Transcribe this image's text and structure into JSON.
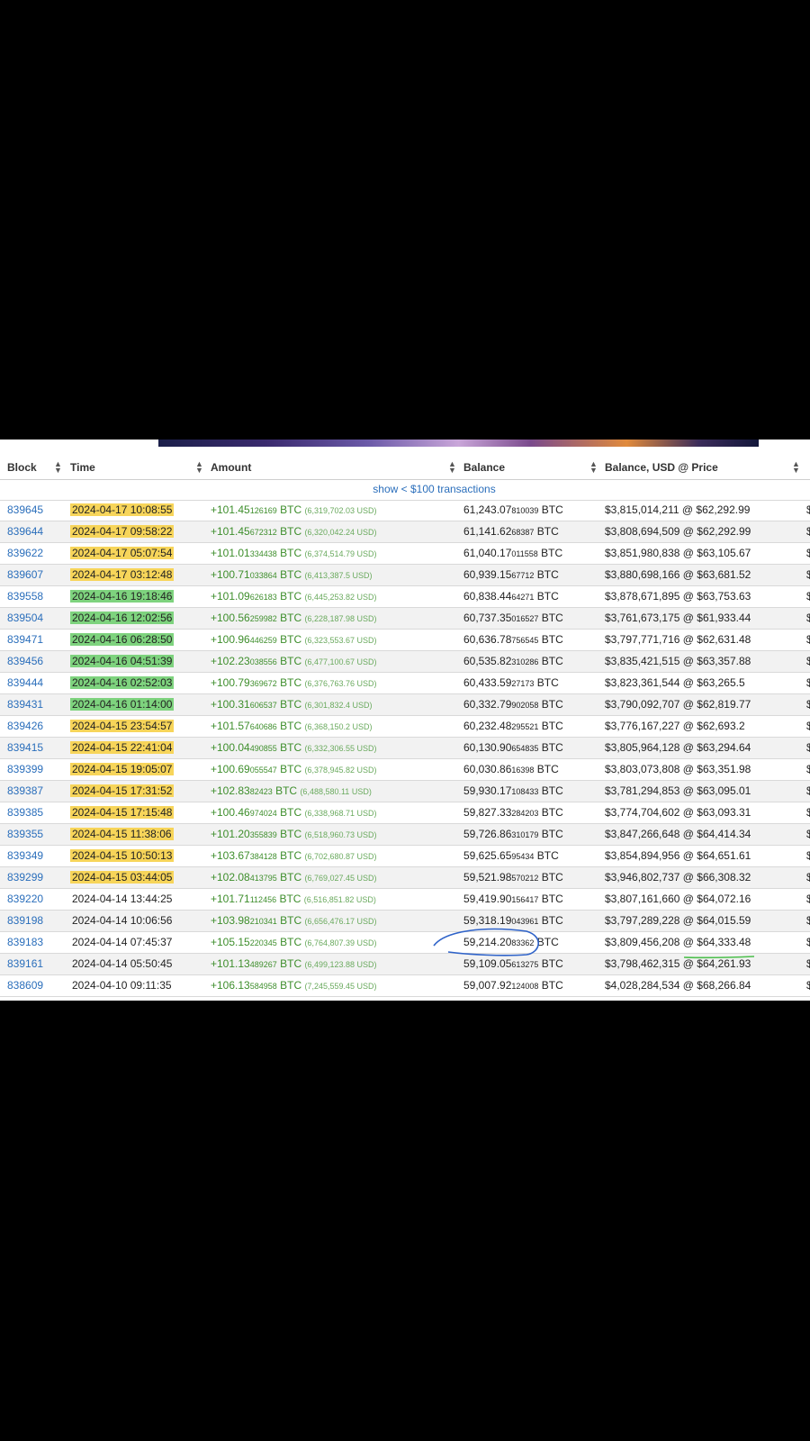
{
  "table": {
    "headers": {
      "block": "Block",
      "time": "Time",
      "amount": "Amount",
      "balance": "Balance",
      "balance_usd": "Balance, USD @ Price"
    },
    "show_small_link": "show < $100 transactions",
    "unit_btc": "BTC",
    "rows": [
      {
        "block": "839645",
        "time": "2024-04-17 10:08:55",
        "amt_main": "+101.45",
        "amt_frac": "126169",
        "amt_usd": "(6,319,702.03 USD)",
        "bal_main": "61,243.07",
        "bal_frac": "810039",
        "bal_usd": "$3,815,014,211",
        "price": "@ $62,292.99",
        "highlight": "yellow"
      },
      {
        "block": "839644",
        "time": "2024-04-17 09:58:22",
        "amt_main": "+101.45",
        "amt_frac": "672312",
        "amt_usd": "(6,320,042.24 USD)",
        "bal_main": "61,141.62",
        "bal_frac": "68387",
        "bal_usd": "$3,808,694,509",
        "price": "@ $62,292.99",
        "highlight": "yellow"
      },
      {
        "block": "839622",
        "time": "2024-04-17 05:07:54",
        "amt_main": "+101.01",
        "amt_frac": "334438",
        "amt_usd": "(6,374,514.79 USD)",
        "bal_main": "61,040.17",
        "bal_frac": "011558",
        "bal_usd": "$3,851,980,838",
        "price": "@ $63,105.67",
        "highlight": "yellow"
      },
      {
        "block": "839607",
        "time": "2024-04-17 03:12:48",
        "amt_main": "+100.71",
        "amt_frac": "033864",
        "amt_usd": "(6,413,387.5 USD)",
        "bal_main": "60,939.15",
        "bal_frac": "67712",
        "bal_usd": "$3,880,698,166",
        "price": "@ $63,681.52",
        "highlight": "yellow"
      },
      {
        "block": "839558",
        "time": "2024-04-16 19:18:46",
        "amt_main": "+101.09",
        "amt_frac": "626183",
        "amt_usd": "(6,445,253.82 USD)",
        "bal_main": "60,838.44",
        "bal_frac": "64271",
        "bal_usd": "$3,878,671,895",
        "price": "@ $63,753.63",
        "highlight": "green"
      },
      {
        "block": "839504",
        "time": "2024-04-16 12:02:56",
        "amt_main": "+100.56",
        "amt_frac": "259982",
        "amt_usd": "(6,228,187.98 USD)",
        "bal_main": "60,737.35",
        "bal_frac": "016527",
        "bal_usd": "$3,761,673,175",
        "price": "@ $61,933.44",
        "highlight": "green"
      },
      {
        "block": "839471",
        "time": "2024-04-16 06:28:50",
        "amt_main": "+100.96",
        "amt_frac": "446259",
        "amt_usd": "(6,323,553.67 USD)",
        "bal_main": "60,636.78",
        "bal_frac": "756545",
        "bal_usd": "$3,797,771,716",
        "price": "@ $62,631.48",
        "highlight": "green"
      },
      {
        "block": "839456",
        "time": "2024-04-16 04:51:39",
        "amt_main": "+102.23",
        "amt_frac": "038556",
        "amt_usd": "(6,477,100.67 USD)",
        "bal_main": "60,535.82",
        "bal_frac": "310286",
        "bal_usd": "$3,835,421,515",
        "price": "@ $63,357.88",
        "highlight": "green"
      },
      {
        "block": "839444",
        "time": "2024-04-16 02:52:03",
        "amt_main": "+100.79",
        "amt_frac": "369672",
        "amt_usd": "(6,376,763.76 USD)",
        "bal_main": "60,433.59",
        "bal_frac": "27173",
        "bal_usd": "$3,823,361,544",
        "price": "@ $63,265.5",
        "highlight": "green"
      },
      {
        "block": "839431",
        "time": "2024-04-16 01:14:00",
        "amt_main": "+100.31",
        "amt_frac": "606537",
        "amt_usd": "(6,301,832.4 USD)",
        "bal_main": "60,332.79",
        "bal_frac": "902058",
        "bal_usd": "$3,790,092,707",
        "price": "@ $62,819.77",
        "highlight": "green"
      },
      {
        "block": "839426",
        "time": "2024-04-15 23:54:57",
        "amt_main": "+101.57",
        "amt_frac": "640686",
        "amt_usd": "(6,368,150.2 USD)",
        "bal_main": "60,232.48",
        "bal_frac": "295521",
        "bal_usd": "$3,776,167,227",
        "price": "@ $62,693.2",
        "highlight": "yellow"
      },
      {
        "block": "839415",
        "time": "2024-04-15 22:41:04",
        "amt_main": "+100.04",
        "amt_frac": "490855",
        "amt_usd": "(6,332,306.55 USD)",
        "bal_main": "60,130.90",
        "bal_frac": "654835",
        "bal_usd": "$3,805,964,128",
        "price": "@ $63,294.64",
        "highlight": "yellow"
      },
      {
        "block": "839399",
        "time": "2024-04-15 19:05:07",
        "amt_main": "+100.69",
        "amt_frac": "055547",
        "amt_usd": "(6,378,945.82 USD)",
        "bal_main": "60,030.86",
        "bal_frac": "16398",
        "bal_usd": "$3,803,073,808",
        "price": "@ $63,351.98",
        "highlight": "yellow"
      },
      {
        "block": "839387",
        "time": "2024-04-15 17:31:52",
        "amt_main": "+102.83",
        "amt_frac": "82423",
        "amt_usd": "(6,488,580.11 USD)",
        "bal_main": "59,930.17",
        "bal_frac": "108433",
        "bal_usd": "$3,781,294,853",
        "price": "@ $63,095.01",
        "highlight": "yellow"
      },
      {
        "block": "839385",
        "time": "2024-04-15 17:15:48",
        "amt_main": "+100.46",
        "amt_frac": "974024",
        "amt_usd": "(6,338,968.71 USD)",
        "bal_main": "59,827.33",
        "bal_frac": "284203",
        "bal_usd": "$3,774,704,602",
        "price": "@ $63,093.31",
        "highlight": "yellow"
      },
      {
        "block": "839355",
        "time": "2024-04-15 11:38:06",
        "amt_main": "+101.20",
        "amt_frac": "355839",
        "amt_usd": "(6,518,960.73 USD)",
        "bal_main": "59,726.86",
        "bal_frac": "310179",
        "bal_usd": "$3,847,266,648",
        "price": "@ $64,414.34",
        "highlight": "yellow"
      },
      {
        "block": "839349",
        "time": "2024-04-15 10:50:13",
        "amt_main": "+103.67",
        "amt_frac": "384128",
        "amt_usd": "(6,702,680.87 USD)",
        "bal_main": "59,625.65",
        "bal_frac": "95434",
        "bal_usd": "$3,854,894,956",
        "price": "@ $64,651.61",
        "highlight": "yellow"
      },
      {
        "block": "839299",
        "time": "2024-04-15 03:44:05",
        "amt_main": "+102.08",
        "amt_frac": "413795",
        "amt_usd": "(6,769,027.45 USD)",
        "bal_main": "59,521.98",
        "bal_frac": "570212",
        "bal_usd": "$3,946,802,737",
        "price": "@ $66,308.32",
        "highlight": "yellow"
      },
      {
        "block": "839220",
        "time": "2024-04-14 13:44:25",
        "amt_main": "+101.71",
        "amt_frac": "112456",
        "amt_usd": "(6,516,851.82 USD)",
        "bal_main": "59,419.90",
        "bal_frac": "156417",
        "bal_usd": "$3,807,161,660",
        "price": "@ $64,072.16",
        "highlight": "none"
      },
      {
        "block": "839198",
        "time": "2024-04-14 10:06:56",
        "amt_main": "+103.98",
        "amt_frac": "210341",
        "amt_usd": "(6,656,476.17 USD)",
        "bal_main": "59,318.19",
        "bal_frac": "043961",
        "bal_usd": "$3,797,289,228",
        "price": "@ $64,015.59",
        "highlight": "none"
      },
      {
        "block": "839183",
        "time": "2024-04-14 07:45:37",
        "amt_main": "+105.15",
        "amt_frac": "220345",
        "amt_usd": "(6,764,807.39 USD)",
        "bal_main": "59,214.20",
        "bal_frac": "83362",
        "bal_usd": "$3,809,456,208",
        "price": "@ $64,333.48",
        "highlight": "none"
      },
      {
        "block": "839161",
        "time": "2024-04-14 05:50:45",
        "amt_main": "+101.13",
        "amt_frac": "489267",
        "amt_usd": "(6,499,123.88 USD)",
        "bal_main": "59,109.05",
        "bal_frac": "613275",
        "bal_usd": "$3,798,462,315",
        "price": "@ $64,261.93",
        "highlight": "none"
      },
      {
        "block": "838609",
        "time": "2024-04-10 09:11:35",
        "amt_main": "+106.13",
        "amt_frac": "584958",
        "amt_usd": "(7,245,559.45 USD)",
        "bal_main": "59,007.92",
        "bal_frac": "124008",
        "bal_usd": "$4,028,284,534",
        "price": "@ $68,266.84",
        "highlight": "none"
      }
    ],
    "edge_glyph": "$"
  },
  "colors": {
    "link": "#2a6ebb",
    "amount_green": "#3e8e2c",
    "highlight_yellow": "#f7d55a",
    "highlight_green": "#7ed37e",
    "annotation_red": "#d9232e",
    "annotation_blue": "#2f63c9",
    "annotation_green": "#4cbf4c"
  }
}
